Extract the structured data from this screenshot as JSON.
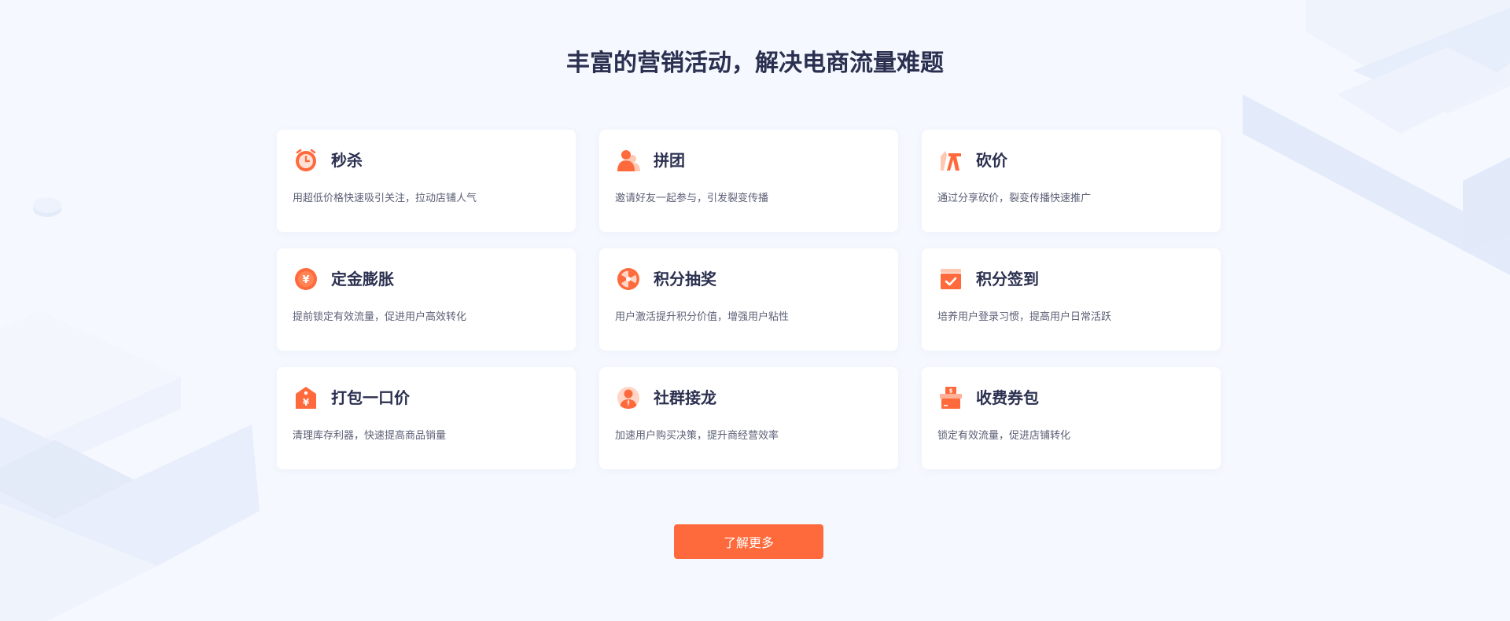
{
  "section": {
    "title": "丰富的营销活动，解决电商流量难题",
    "more_label": "了解更多"
  },
  "colors": {
    "accent": "#ff6a3c",
    "background": "#f5f8fe",
    "card": "#ffffff",
    "title": "#2b3050",
    "desc": "#5b6076"
  },
  "cards": [
    {
      "icon": "alarm-clock-icon",
      "title": "秒杀",
      "desc": "用超低价格快速吸引关注，拉动店铺人气"
    },
    {
      "icon": "group-users-icon",
      "title": "拼团",
      "desc": "邀请好友一起参与，引发裂变传播"
    },
    {
      "icon": "price-cut-icon",
      "title": "砍价",
      "desc": "通过分享砍价，裂变传播快速推广"
    },
    {
      "icon": "yen-coin-icon",
      "title": "定金膨胀",
      "desc": "提前锁定有效流量，促进用户高效转化"
    },
    {
      "icon": "prize-wheel-icon",
      "title": "积分抽奖",
      "desc": "用户激活提升积分价值，增强用户粘性"
    },
    {
      "icon": "calendar-check-icon",
      "title": "积分签到",
      "desc": "培养用户登录习惯，提高用户日常活跃"
    },
    {
      "icon": "price-tag-icon",
      "title": "打包一口价",
      "desc": "清理库存利器，快速提高商品销量"
    },
    {
      "icon": "community-leader-icon",
      "title": "社群接龙",
      "desc": "加速用户购买决策，提升商经营效率"
    },
    {
      "icon": "gift-coupon-icon",
      "title": "收费券包",
      "desc": "锁定有效流量，促进店铺转化"
    }
  ]
}
